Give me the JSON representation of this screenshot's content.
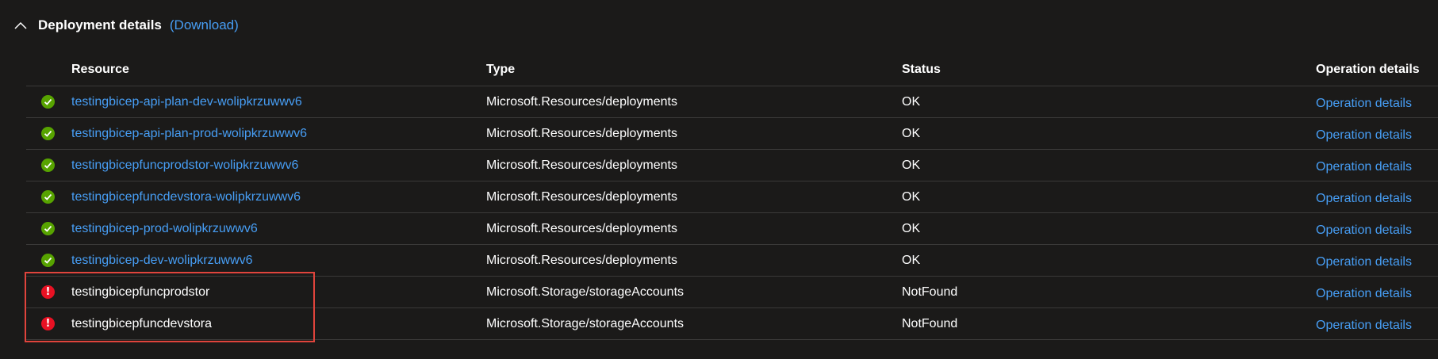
{
  "section": {
    "title": "Deployment details",
    "download_label": "(Download)"
  },
  "table": {
    "headers": {
      "resource": "Resource",
      "type": "Type",
      "status": "Status",
      "operation": "Operation details"
    },
    "rows": [
      {
        "status_icon": "success-check-icon",
        "resource": "testingbicep-api-plan-dev-wolipkrzuwwv6",
        "resource_is_link": true,
        "type": "Microsoft.Resources/deployments",
        "status": "OK",
        "operation": "Operation details"
      },
      {
        "status_icon": "success-check-icon",
        "resource": "testingbicep-api-plan-prod-wolipkrzuwwv6",
        "resource_is_link": true,
        "type": "Microsoft.Resources/deployments",
        "status": "OK",
        "operation": "Operation details"
      },
      {
        "status_icon": "success-check-icon",
        "resource": "testingbicepfuncprodstor-wolipkrzuwwv6",
        "resource_is_link": true,
        "type": "Microsoft.Resources/deployments",
        "status": "OK",
        "operation": "Operation details"
      },
      {
        "status_icon": "success-check-icon",
        "resource": "testingbicepfuncdevstora-wolipkrzuwwv6",
        "resource_is_link": true,
        "type": "Microsoft.Resources/deployments",
        "status": "OK",
        "operation": "Operation details"
      },
      {
        "status_icon": "success-check-icon",
        "resource": "testingbicep-prod-wolipkrzuwwv6",
        "resource_is_link": true,
        "type": "Microsoft.Resources/deployments",
        "status": "OK",
        "operation": "Operation details"
      },
      {
        "status_icon": "success-check-icon",
        "resource": "testingbicep-dev-wolipkrzuwwv6",
        "resource_is_link": true,
        "type": "Microsoft.Resources/deployments",
        "status": "OK",
        "operation": "Operation details"
      },
      {
        "status_icon": "error-icon",
        "resource": "testingbicepfuncprodstor",
        "resource_is_link": false,
        "type": "Microsoft.Storage/storageAccounts",
        "status": "NotFound",
        "operation": "Operation details"
      },
      {
        "status_icon": "error-icon",
        "resource": "testingbicepfuncdevstora",
        "resource_is_link": false,
        "type": "Microsoft.Storage/storageAccounts",
        "status": "NotFound",
        "operation": "Operation details"
      }
    ]
  },
  "colors": {
    "background": "#1b1a19",
    "link": "#479ef5",
    "success": "#57a300",
    "error": "#e81123",
    "highlight": "#e0443c",
    "divider": "#3b3a39"
  }
}
